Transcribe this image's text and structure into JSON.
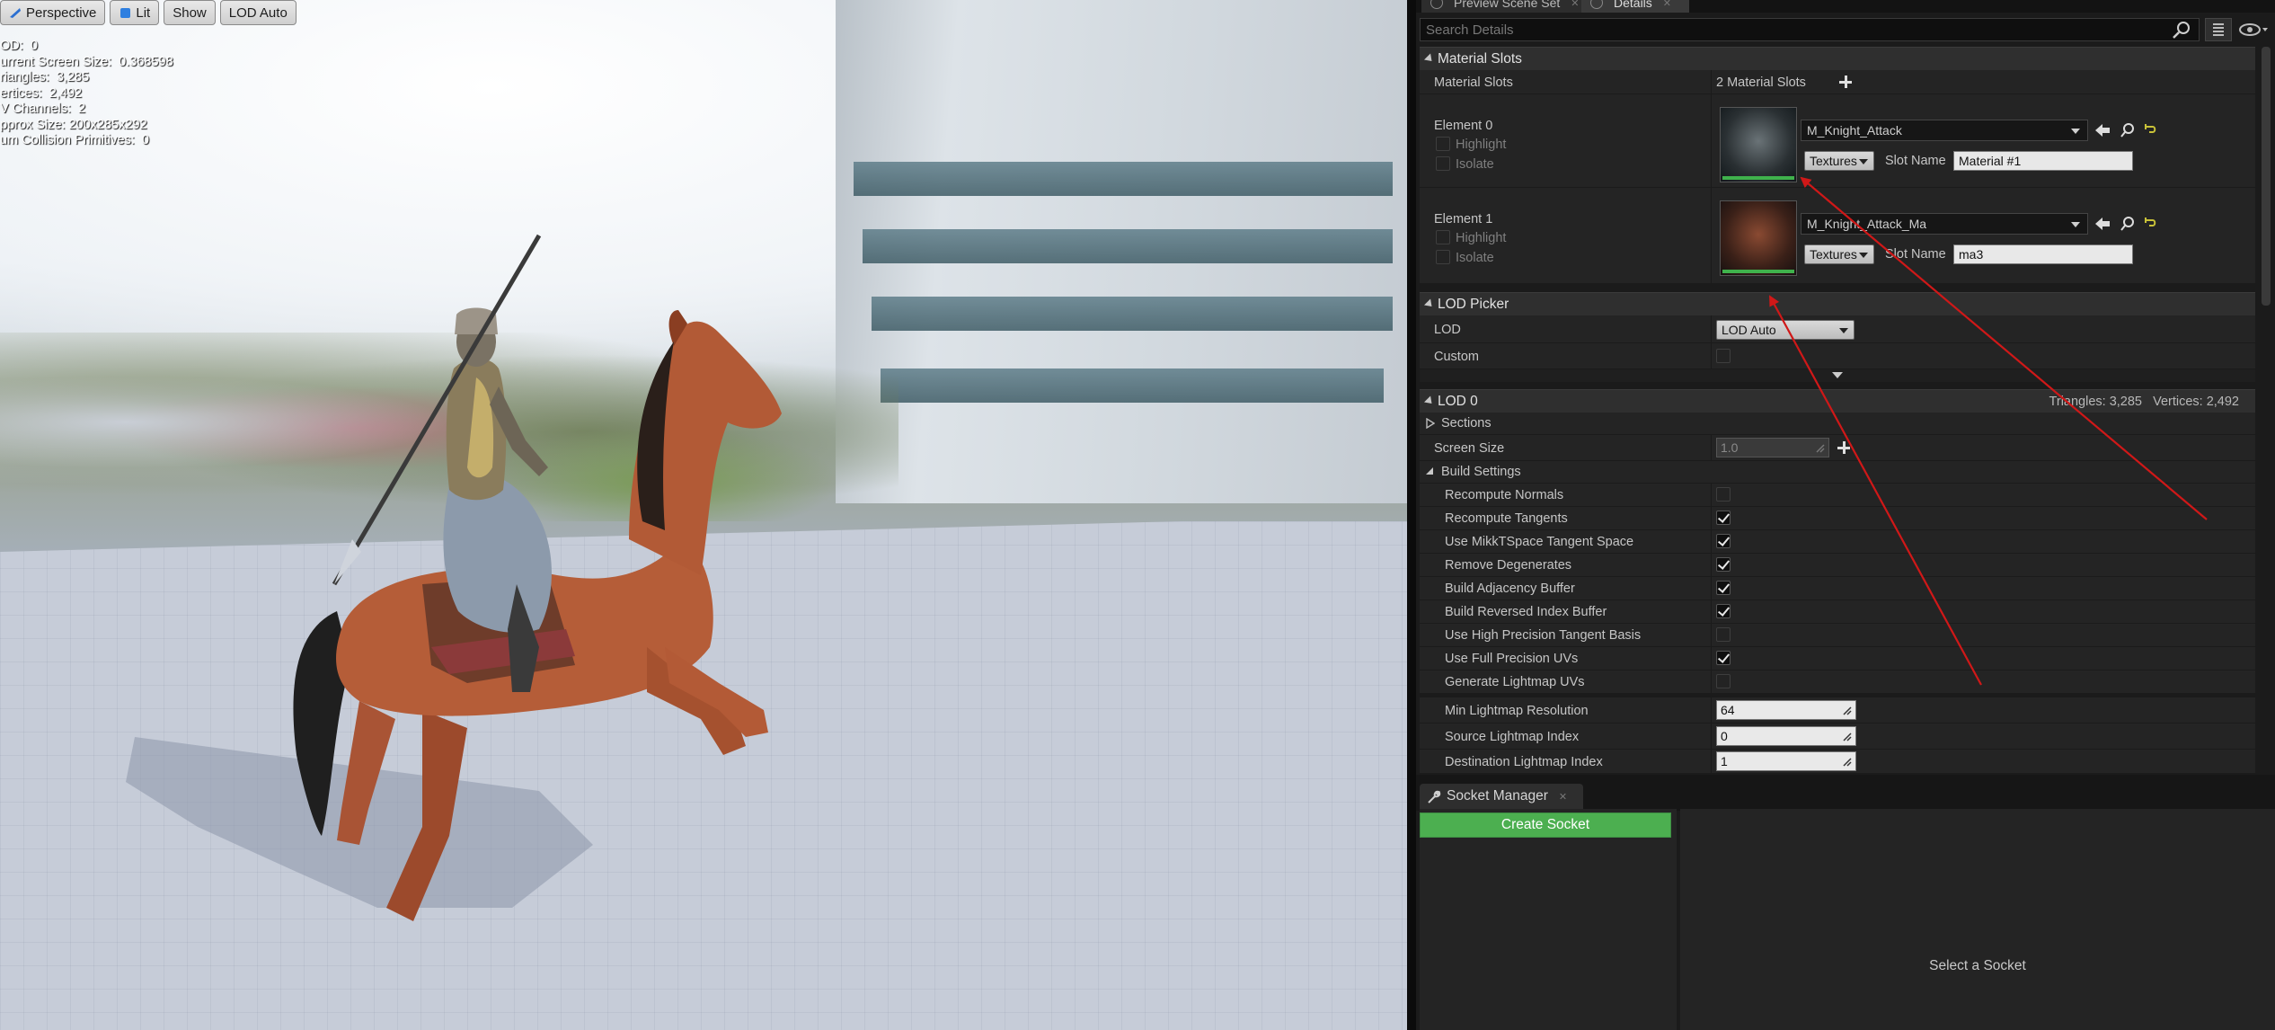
{
  "viewport": {
    "toolbar": {
      "perspective_label": "Perspective",
      "lit_label": "Lit",
      "show_label": "Show",
      "lod_label": "LOD Auto"
    },
    "stats": [
      "OD:  0",
      "urrent Screen Size:  0.368598",
      "riangles:  3,285",
      "ertices:  2,492",
      "V Channels:  2",
      "pprox Size: 200x285x292",
      "um Collision Primitives:  0"
    ]
  },
  "tabs": {
    "preview_scene_set": "Preview Scene Set",
    "details": "Details"
  },
  "search": {
    "placeholder": "Search Details"
  },
  "material_slots": {
    "header": "Material Slots",
    "row_label": "Material Slots",
    "count_text": "2 Material Slots",
    "elements": [
      {
        "label": "Element 0",
        "highlight_label": "Highlight",
        "isolate_label": "Isolate",
        "material": "M_Knight_Attack",
        "textures_label": "Textures",
        "slot_name_label": "Slot Name",
        "slot_name_value": "Material #1"
      },
      {
        "label": "Element 1",
        "highlight_label": "Highlight",
        "isolate_label": "Isolate",
        "material": "M_Knight_Attack_Ma",
        "textures_label": "Textures",
        "slot_name_label": "Slot Name",
        "slot_name_value": "ma3"
      }
    ]
  },
  "lod_picker": {
    "header": "LOD Picker",
    "lod_label": "LOD",
    "lod_value": "LOD Auto",
    "custom_label": "Custom",
    "custom_checked": false
  },
  "lod0": {
    "header": "LOD 0",
    "summary": "Triangles: 3,285   Vertices: 2,492",
    "sections_label": "Sections",
    "screen_size_label": "Screen Size",
    "screen_size_value": "1.0",
    "build_settings_label": "Build Settings",
    "settings": [
      {
        "label": "Recompute Normals",
        "checked": false
      },
      {
        "label": "Recompute Tangents",
        "checked": true
      },
      {
        "label": "Use MikkTSpace Tangent Space",
        "checked": true
      },
      {
        "label": "Remove Degenerates",
        "checked": true
      },
      {
        "label": "Build Adjacency Buffer",
        "checked": true
      },
      {
        "label": "Build Reversed Index Buffer",
        "checked": true
      },
      {
        "label": "Use High Precision Tangent Basis",
        "checked": false
      },
      {
        "label": "Use Full Precision UVs",
        "checked": true
      },
      {
        "label": "Generate Lightmap UVs",
        "checked": false
      }
    ],
    "min_lightmap_label": "Min Lightmap Resolution",
    "min_lightmap_value": "64",
    "source_lightmap_label": "Source Lightmap Index",
    "source_lightmap_value": "0",
    "dest_lightmap_label": "Destination Lightmap Index",
    "dest_lightmap_value": "1"
  },
  "socket_manager": {
    "tab_label": "Socket Manager",
    "create_label": "Create Socket",
    "empty_text": "Select a Socket"
  },
  "colors": {
    "panel_bg": "#1b1b1b",
    "row_bg": "#242424",
    "header_bg": "#2f2f2f",
    "accent_green": "#4caf50",
    "annotation_red": "#d01818"
  },
  "icons": [
    "search-icon",
    "grid-view-icon",
    "eye-icon",
    "plus-icon",
    "browse-arrow-icon",
    "find-icon",
    "reset-icon",
    "wrench-icon"
  ]
}
